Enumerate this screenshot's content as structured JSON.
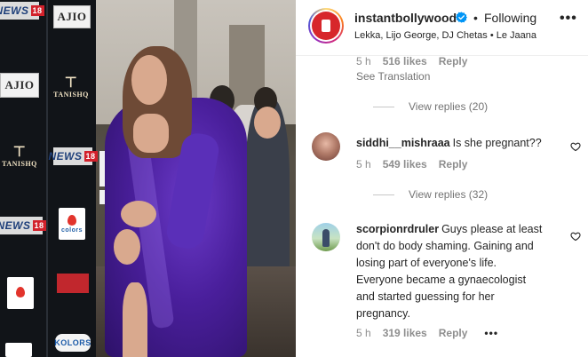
{
  "photo": {
    "logos": [
      "NEWS",
      "18",
      "AJIO",
      "AJIO",
      "TANISHQ",
      "TANISHQ",
      "NEWS",
      "18",
      "NEWS",
      "18",
      "colors",
      "KOLORS"
    ]
  },
  "header": {
    "username": "instantbollywood",
    "dot": "•",
    "follow_status": "Following",
    "more": "•••",
    "subtitle": "Lekka, Lijo George, DJ Chetas • Le Jaana",
    "avatar_text": "INSTANT BOLLYWOOD"
  },
  "comments": {
    "prev_meta": {
      "time": "5 h",
      "likes": "516 likes",
      "reply": "Reply"
    },
    "see_translation": "See Translation",
    "view_replies_1": "View replies (20)",
    "c1": {
      "username": "siddhi__mishraaa",
      "text": "Is she pregnant??",
      "time": "5 h",
      "likes": "549 likes",
      "reply": "Reply"
    },
    "view_replies_2": "View replies (32)",
    "c2": {
      "username": "scorpionrdruler",
      "lines": [
        "Guys please at least",
        "don't do body shaming. Gaining and",
        "losing part of everyone's life.",
        "Everyone became a gynaecologist",
        "and started guessing for her",
        "pregnancy."
      ],
      "time": "5 h",
      "likes": "319 likes",
      "reply": "Reply",
      "more": "•••"
    }
  },
  "colors": {
    "accent_blue": "#0095f6",
    "meta_gray": "#8e8e8e",
    "text": "#262626",
    "dress_purple": "#4a1f9c"
  }
}
